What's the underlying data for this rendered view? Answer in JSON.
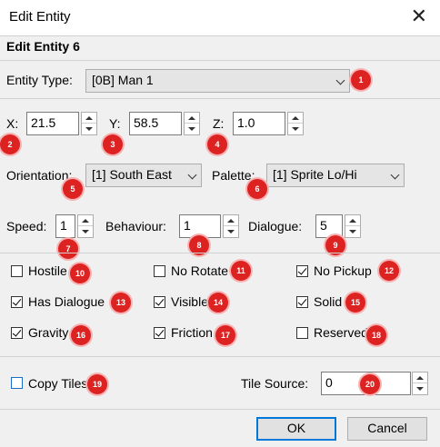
{
  "window": {
    "title": "Edit Entity",
    "close_glyph": "✕"
  },
  "heading": "Edit Entity 6",
  "entity_type": {
    "label": "Entity Type:",
    "value": "[0B] Man 1"
  },
  "position": {
    "x": {
      "label": "X:",
      "value": "21.5"
    },
    "y": {
      "label": "Y:",
      "value": "58.5"
    },
    "z": {
      "label": "Z:",
      "value": "1.0"
    }
  },
  "orientation": {
    "label": "Orientation:",
    "value": "[1] South East"
  },
  "palette": {
    "label": "Palette:",
    "value": "[1] Sprite Lo/Hi"
  },
  "speed": {
    "label": "Speed:",
    "value": "1"
  },
  "behaviour": {
    "label": "Behaviour:",
    "value": "1"
  },
  "dialogue": {
    "label": "Dialogue:",
    "value": "5"
  },
  "flags": [
    {
      "label": "Hostile",
      "checked": false
    },
    {
      "label": "No Rotate",
      "checked": false
    },
    {
      "label": "No Pickup",
      "checked": true
    },
    {
      "label": "Has Dialogue",
      "checked": true
    },
    {
      "label": "Visible",
      "checked": true
    },
    {
      "label": "Solid",
      "checked": true
    },
    {
      "label": "Gravity",
      "checked": true
    },
    {
      "label": "Friction",
      "checked": true
    },
    {
      "label": "Reserved",
      "checked": false
    }
  ],
  "copy_tiles": {
    "label": "Copy Tiles",
    "checked": false
  },
  "tile_source": {
    "label": "Tile Source:",
    "value": "0"
  },
  "buttons": {
    "ok": "OK",
    "cancel": "Cancel"
  },
  "badges": [
    "1",
    "2",
    "3",
    "4",
    "5",
    "6",
    "7",
    "8",
    "9",
    "10",
    "11",
    "12",
    "13",
    "14",
    "15",
    "16",
    "17",
    "18",
    "19",
    "20"
  ],
  "colors": {
    "badge": "#dd2222",
    "focus": "#0078d7"
  }
}
